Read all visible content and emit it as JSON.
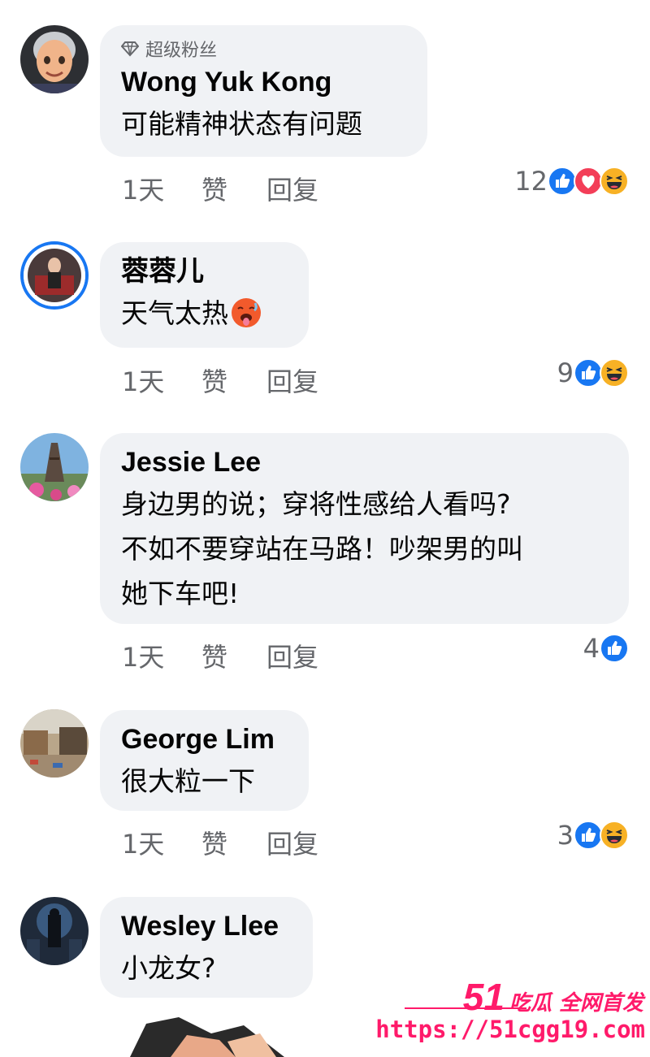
{
  "comments": [
    {
      "badge": "超级粉丝",
      "author": "Wong Yuk Kong",
      "lines": [
        "可能精神状态有问题"
      ],
      "time": "1天",
      "like_label": "赞",
      "reply_label": "回复",
      "reaction_count": "12",
      "reactions": [
        "like",
        "love",
        "haha"
      ]
    },
    {
      "author": "蓉蓉儿",
      "lines": [
        "天气太热"
      ],
      "emoji": "hot-face",
      "time": "1天",
      "like_label": "赞",
      "reply_label": "回复",
      "reaction_count": "9",
      "reactions": [
        "like",
        "haha"
      ]
    },
    {
      "author": "Jessie Lee",
      "lines": [
        "身边男的说；穿将性感给人看吗?",
        "不如不要穿站在马路！吵架男的叫",
        "她下车吧!"
      ],
      "time": "1天",
      "like_label": "赞",
      "reply_label": "回复",
      "reaction_count": "4",
      "reactions": [
        "like"
      ]
    },
    {
      "author": "George Lim",
      "lines": [
        "很大粒一下"
      ],
      "time": "1天",
      "like_label": "赞",
      "reply_label": "回复",
      "reaction_count": "3",
      "reactions": [
        "like",
        "haha"
      ]
    },
    {
      "author": "Wesley Llee",
      "lines": [
        "小龙女?"
      ]
    }
  ],
  "watermark": {
    "number": "51",
    "brand": "吃瓜 全网首发",
    "url": "https://51cgg19.com"
  },
  "colors": {
    "bubble": "#f0f2f5",
    "text": "#050505",
    "meta": "#65676b",
    "like_blue": "#1877f2",
    "love_red": "#f33e58",
    "haha_yellow": "#f7b125",
    "watermark_pink": "#ff1a6a"
  }
}
